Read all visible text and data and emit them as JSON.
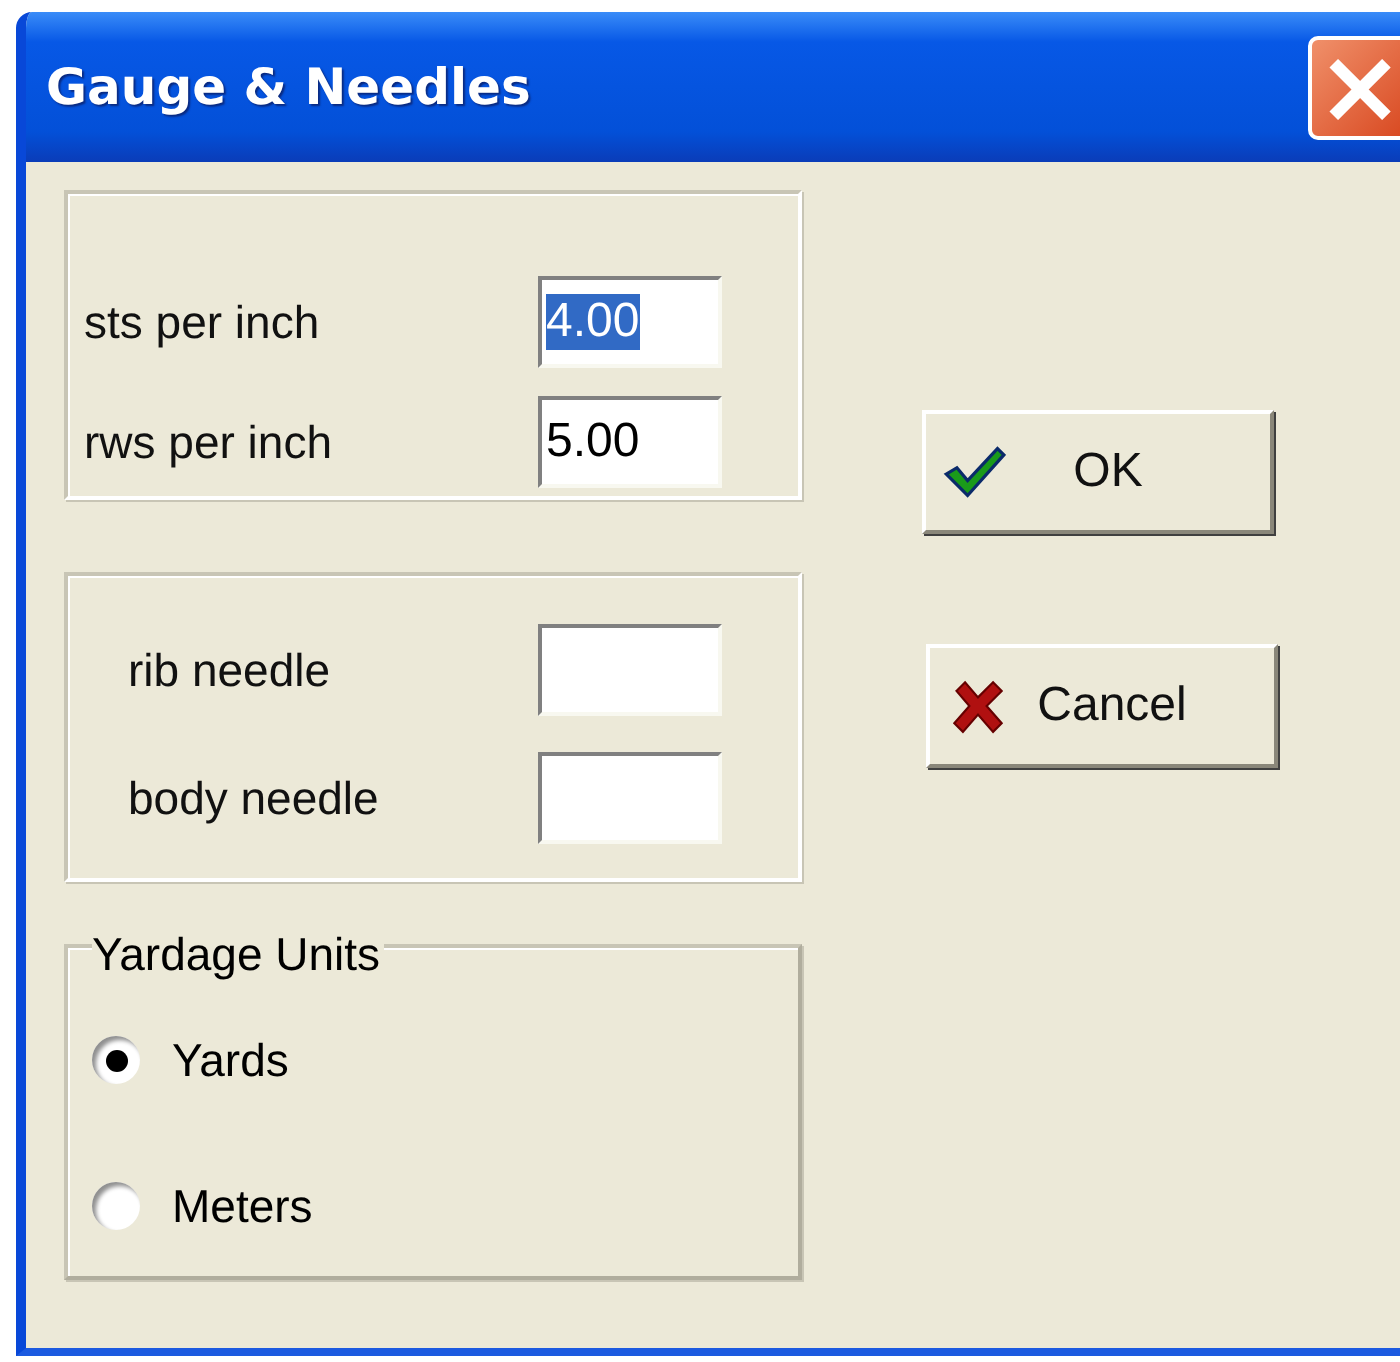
{
  "window": {
    "title": "Gauge & Needles",
    "close": "×"
  },
  "gauge": [
    {
      "label": "sts per inch",
      "value": "4.00",
      "highlighted": true
    },
    {
      "label": "rws per inch",
      "value": "5.00",
      "highlighted": false
    }
  ],
  "needles": [
    {
      "label": "rib needle"
    },
    {
      "label": "body needle"
    }
  ],
  "yardage_units": {
    "title": "Yardage Units",
    "options": [
      {
        "label": "Yards",
        "selected": true
      },
      {
        "label": "Meters",
        "selected": false
      }
    ]
  },
  "buttons": [
    {
      "label": "OK",
      "kind": "ok"
    },
    {
      "label": "Cancel",
      "kind": "cancel"
    }
  ]
}
